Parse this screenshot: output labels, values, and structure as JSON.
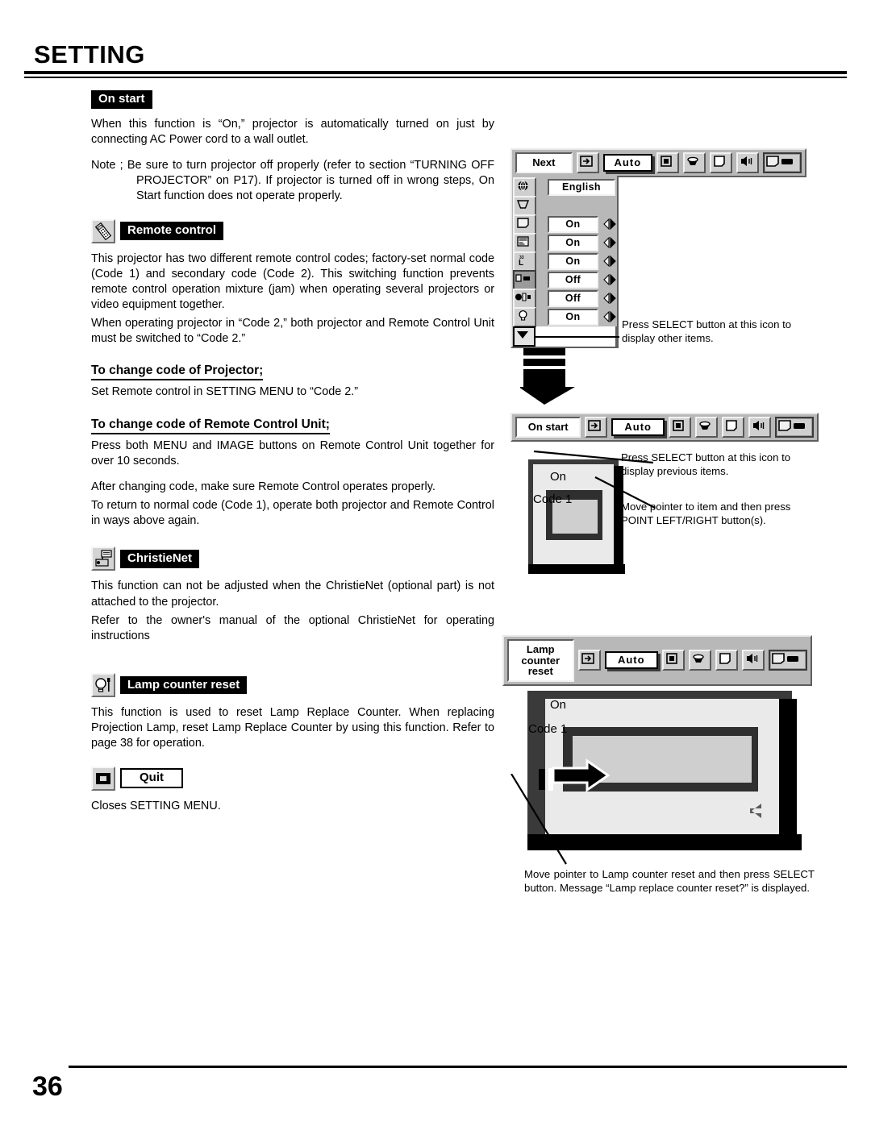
{
  "page": {
    "title": "SETTING",
    "number": "36"
  },
  "sections": {
    "on_start": {
      "tag": "On start",
      "paragraphs": [
        "When this function is “On,” projector is automatically turned on just by connecting AC Power cord to a wall outlet."
      ],
      "note": "Note ; Be sure to turn projector off properly (refer to section “TURNING OFF PROJECTOR” on P17).  If projector is turned off in wrong steps, On Start function does not operate properly."
    },
    "remote_control": {
      "tag": "Remote control",
      "icon": "remote-control-icon",
      "paragraphs": [
        "This projector has two different remote control codes; factory-set normal code (Code 1) and secondary code (Code 2).  This switching function prevents remote control operation mixture (jam) when operating several projectors or video equipment together.",
        "When operating projector in “Code 2,”  both projector and Remote Control Unit must be switched to “Code 2.”"
      ],
      "sub1_heading": "To change code of Projector;",
      "sub1_body": "Set Remote control in SETTING MENU to “Code 2.”",
      "sub2_heading": "To change code of Remote Control Unit;",
      "sub2_body": "Press both MENU and IMAGE buttons on Remote Control Unit together for over 10 seconds.",
      "closing1": "After changing code, make sure Remote Control operates properly.",
      "closing2": "To return to normal code (Code 1), operate both projector and Remote Control in ways above again."
    },
    "christienet": {
      "tag": "ChristieNet",
      "icon": "christienet-icon",
      "paragraphs": [
        "This function can not be adjusted when the ChristieNet (optional part) is not attached to the projector.",
        "Refer to the owner's manual of the optional ChristieNet for operating instructions"
      ]
    },
    "lamp_counter_reset": {
      "tag": "Lamp counter reset",
      "icon": "lamp-counter-icon",
      "paragraphs": [
        "This function is used to reset Lamp Replace Counter.  When replacing Projection Lamp, reset Lamp Replace Counter by using this function.  Refer to page 38 for operation."
      ]
    },
    "quit": {
      "tag": "Quit",
      "icon": "quit-icon",
      "paragraphs": [
        "Closes SETTING MENU."
      ]
    }
  },
  "figures": {
    "menu_next": {
      "title": "Next",
      "toolbar": {
        "auto_label": "Auto",
        "icons": [
          "input-icon",
          "auto-pc-adj-button",
          "image-select-icon",
          "image-adjust-icon",
          "screen-icon",
          "sound-icon",
          "setting-icon"
        ]
      },
      "rows": [
        {
          "icon": "language-globe-icon",
          "value": "English",
          "arrows": false
        },
        {
          "icon": "keystone-icon",
          "value": "",
          "arrows": false
        },
        {
          "icon": "blue-back-icon",
          "value": "On",
          "arrows": true
        },
        {
          "icon": "display-icon",
          "value": "On",
          "arrows": true
        },
        {
          "icon": "logo-icon",
          "value": "On",
          "arrows": true
        },
        {
          "icon": "ceiling-icon",
          "value": "Off",
          "arrows": true
        },
        {
          "icon": "rear-icon",
          "value": "Off",
          "arrows": true
        },
        {
          "icon": "lamp-icon",
          "value": "On",
          "arrows": true
        }
      ],
      "down_button": "scroll-down-icon",
      "callout": "Press SELECT button at this icon to display other items."
    },
    "menu_on_start": {
      "title": "On start",
      "toolbar": {
        "auto_label": "Auto"
      },
      "screen_labels": {
        "line1": "On",
        "line2": "Code 1"
      },
      "callout1": "Press SELECT button at this icon to display previous items.",
      "callout2": "Move pointer to item and then press POINT LEFT/RIGHT button(s)."
    },
    "menu_lamp_reset": {
      "title_line1": "Lamp",
      "title_line2": "counter reset",
      "toolbar": {
        "auto_label": "Auto"
      },
      "screen_labels": {
        "line1": "On",
        "line2": "Code 1"
      },
      "caption": "Move pointer to Lamp counter reset and then press SELECT button.  Message “Lamp replace counter reset?” is displayed."
    }
  }
}
